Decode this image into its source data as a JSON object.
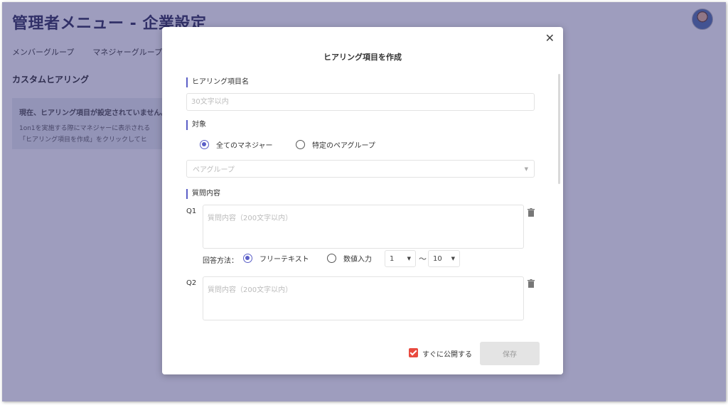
{
  "page": {
    "title": "管理者メニュー - 企業設定",
    "tabs": [
      "メンバーグループ",
      "マネジャーグループ"
    ],
    "section_title": "カスタムヒアリング",
    "empty_title": "現在、ヒアリング項目が設定されていません。",
    "empty_line1": "1on1を実施する際にマネジャーに表示される",
    "empty_line2": "「ヒアリング項目を作成」をクリックしてヒ"
  },
  "modal": {
    "title": "ヒアリング項目を作成",
    "name_label": "ヒアリング項目名",
    "name_placeholder": "30文字以内",
    "target_label": "対象",
    "target_options": [
      "全てのマネジャー",
      "特定のペアグループ"
    ],
    "target_selected": 0,
    "pair_group_placeholder": "ペアグループ",
    "questions_label": "質問内容",
    "questions": [
      {
        "label": "Q1",
        "placeholder": "質問内容（200文字以内）",
        "answer_label": "回答方法：",
        "answer_options": [
          "フリーテキスト",
          "数値入力"
        ],
        "answer_selected": 0,
        "range_min": "1",
        "range_sep": "〜",
        "range_max": "10"
      },
      {
        "label": "Q2",
        "placeholder": "質問内容（200文字以内）"
      }
    ],
    "publish_label": "すぐに公開する",
    "publish_checked": true,
    "save_label": "保存"
  },
  "colors": {
    "accent": "#5b5fc7",
    "checkbox": "#e94a3f",
    "overlay": "#28266e"
  },
  "icons": {
    "close": "close-icon",
    "trash": "trash-icon",
    "caret": "chevron-down-icon"
  }
}
